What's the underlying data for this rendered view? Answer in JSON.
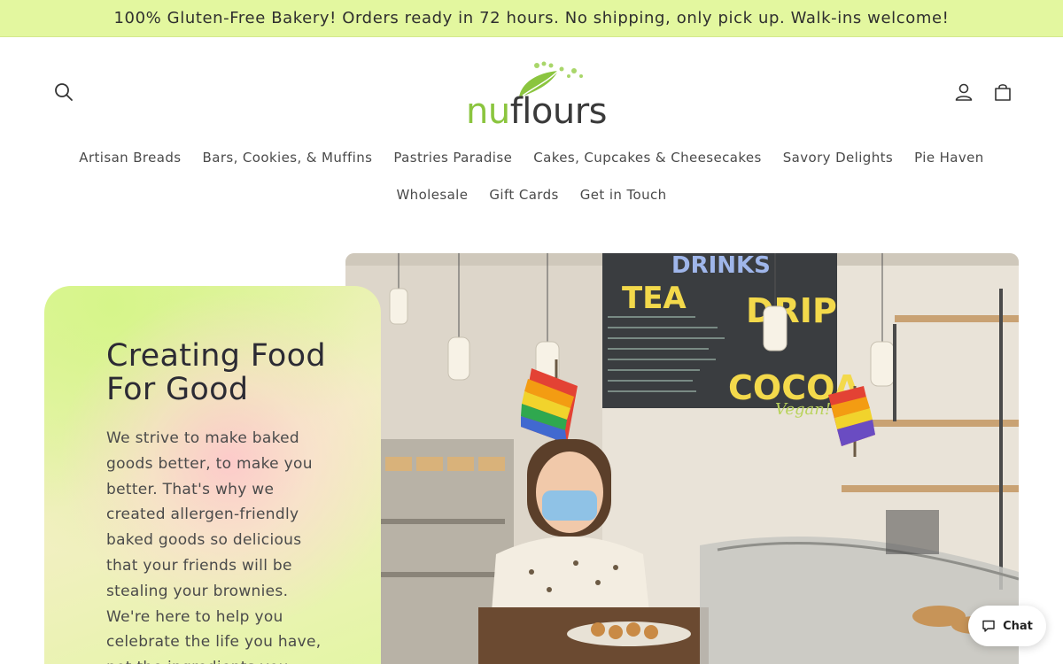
{
  "announcement": {
    "text": "100% Gluten-Free Bakery! Orders ready in 72 hours. No shipping, only pick up. Walk-ins welcome!"
  },
  "header": {
    "logo": {
      "part1": "nu",
      "part2": "flours"
    },
    "icons": {
      "search": "search-icon",
      "account": "user-icon",
      "cart": "bag-icon"
    }
  },
  "nav": {
    "row1": [
      "Artisan Breads",
      "Bars, Cookies, & Muffins",
      "Pastries Paradise",
      "Cakes, Cupcakes & Cheesecakes",
      "Savory Delights",
      "Pie Haven"
    ],
    "row2": [
      "Wholesale",
      "Gift Cards",
      "Get in Touch"
    ]
  },
  "hero": {
    "title": "Creating Food For Good",
    "text": "We strive to make baked goods better, to make you better. That's why we created allergen-friendly baked goods so delicious that your friends will be stealing your brownies. We're here to help you celebrate the life you have, not the ingredients you"
  },
  "chalkboard": {
    "heading": "DRINKS",
    "col1": "TEA",
    "col2": "DRIP",
    "col3": "COCOA",
    "note": "Vegan!"
  },
  "chat": {
    "label": "Chat",
    "icon": "chat-bubble-icon"
  },
  "colors": {
    "announcement_bg": "#e3f79f",
    "brand_green": "#8bc53f",
    "text_dark": "#2c2b34"
  }
}
